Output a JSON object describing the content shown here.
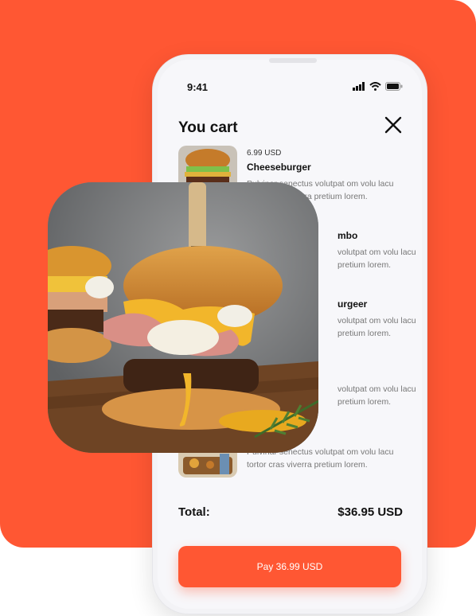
{
  "status": {
    "time": "9:41"
  },
  "cart": {
    "title": "You cart",
    "items": [
      {
        "price": "6.99 USD",
        "name": "Cheeseburger",
        "desc": "Pulvinar senectus volutpat om volu lacu tortor cras viverra pretium lorem."
      },
      {
        "price": "",
        "name": "mbo",
        "desc": "volutpat om volu lacu pretium lorem."
      },
      {
        "price": "",
        "name": "urgeer",
        "desc": "volutpat om volu lacu pretium lorem."
      },
      {
        "price": "",
        "name": "",
        "desc": "volutpat om volu lacu pretium lorem."
      },
      {
        "price": "",
        "name": "",
        "desc": "Pulvinar senectus volutpat om volu lacu tortor cras viverra pretium lorem."
      }
    ],
    "total_label": "Total:",
    "total_value": "$36.95 USD",
    "pay_label": "Pay 36.99 USD"
  },
  "colors": {
    "accent": "#FF5733",
    "background": "#F7F7FA"
  }
}
